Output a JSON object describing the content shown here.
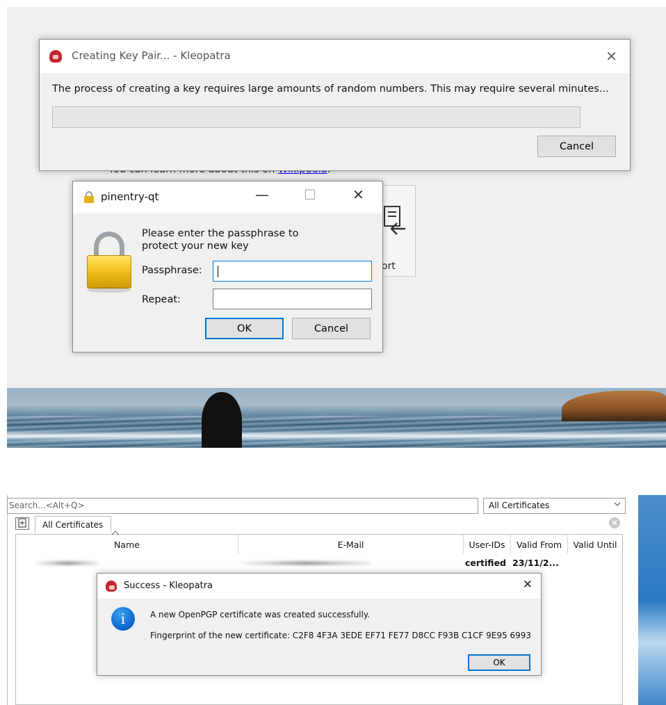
{
  "keypair_dialog": {
    "title": "Creating Key Pair... - Kleopatra",
    "message": "The process of creating a key requires large amounts of random numbers. This may require several minutes...",
    "cancel_label": "Cancel",
    "close_glyph": "✕"
  },
  "background": {
    "learn_more_prefix": "You can learn more about this on ",
    "learn_more_link": "Wikipedia",
    "learn_more_suffix": ".",
    "import_button_fragment": "ort",
    "import_icon": "import-icon"
  },
  "pinentry": {
    "title": "pinentry-qt",
    "prompt": "Please enter the passphrase to protect your new key",
    "passphrase_label": "Passphrase:",
    "repeat_label": "Repeat:",
    "ok_label": "OK",
    "cancel_label": "Cancel",
    "minimize_glyph": "—",
    "maximize_glyph": "☐",
    "close_glyph": "✕"
  },
  "kleopatra_main": {
    "search_placeholder": "Search...<Alt+Q>",
    "filter_selected": "All Certificates",
    "tab_label": "All Certificates",
    "columns": [
      "Name",
      "E-Mail",
      "User-IDs",
      "Valid From",
      "Valid Until"
    ],
    "rows": [
      {
        "user_ids": "certified",
        "valid_from": "23/11/2..."
      }
    ]
  },
  "success_dialog": {
    "title": "Success - Kleopatra",
    "message": "A new OpenPGP certificate was created successfully.",
    "fingerprint_line": "Fingerprint of the new certificate: C2F8 4F3A 3EDE EF71 FE77  D8CC F93B C1CF 9E95 6993",
    "ok_label": "OK",
    "close_glyph": "✕"
  },
  "colors": {
    "accent": "#0078d7",
    "link": "#0000ee",
    "kleopatra_brand": "#c1272d",
    "info_blue": "#0a63c8"
  }
}
